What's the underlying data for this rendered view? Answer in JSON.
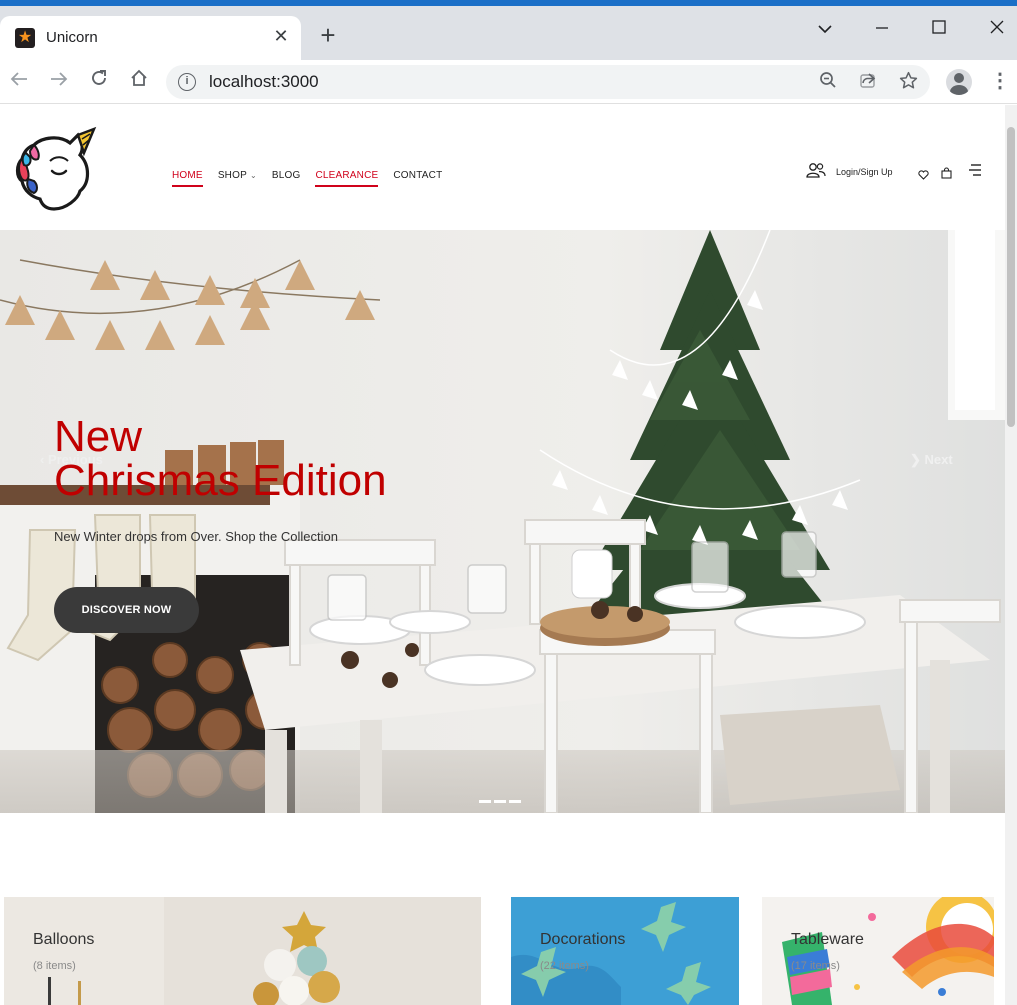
{
  "browser": {
    "tab_title": "Unicorn",
    "url": "localhost:3000"
  },
  "site": {
    "nav": [
      {
        "label": "HOME",
        "state": "active",
        "dropdown": false
      },
      {
        "label": "SHOP",
        "state": "normal",
        "dropdown": true
      },
      {
        "label": "BLOG",
        "state": "normal",
        "dropdown": false
      },
      {
        "label": "CLEARANCE",
        "state": "highlight",
        "dropdown": false
      },
      {
        "label": "CONTACT",
        "state": "normal",
        "dropdown": false
      }
    ],
    "login_label": "Login/Sign Up",
    "accent_color": "#d0021b"
  },
  "hero": {
    "title_line1": "New",
    "title_line2": "Chrismas Edition",
    "subtitle": "New Winter drops from Over. Shop the Collection",
    "button_label": "DISCOVER NOW",
    "prev_label": "Previous",
    "next_label": "Next",
    "slide_count": 3
  },
  "categories": [
    {
      "name": "Balloons",
      "count": "(8 items)"
    },
    {
      "name": "Docorations",
      "count": "(22 items)"
    },
    {
      "name": "Tableware",
      "count": "(17 items)"
    }
  ]
}
